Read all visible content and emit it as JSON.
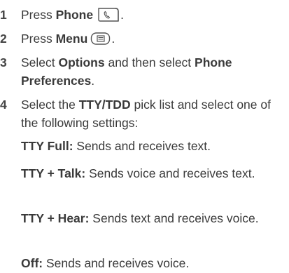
{
  "steps": [
    {
      "number": "1",
      "text_before": "Press ",
      "bold": "Phone",
      "icon": "phone-key-icon",
      "text_after": "."
    },
    {
      "number": "2",
      "text_before": "Press ",
      "bold": "Menu",
      "icon": "menu-key-icon",
      "text_after": "."
    },
    {
      "number": "3",
      "part1": "Select ",
      "bold1": "Options",
      "part2": " and then select ",
      "bold2": "Phone Preferences",
      "part3": "."
    },
    {
      "number": "4",
      "part1": "Select the ",
      "bold1": "TTY/TDD",
      "part2": " pick list and select one of the following settings:"
    }
  ],
  "settings": [
    {
      "name": "TTY Full:",
      "description": " Sends and receives text."
    },
    {
      "name": "TTY + Talk:",
      "description": " Sends voice and receives text."
    },
    {
      "name": "TTY + Hear:",
      "description": " Sends text and receives voice."
    },
    {
      "name": "Off:",
      "description": " Sends and receives voice."
    }
  ]
}
